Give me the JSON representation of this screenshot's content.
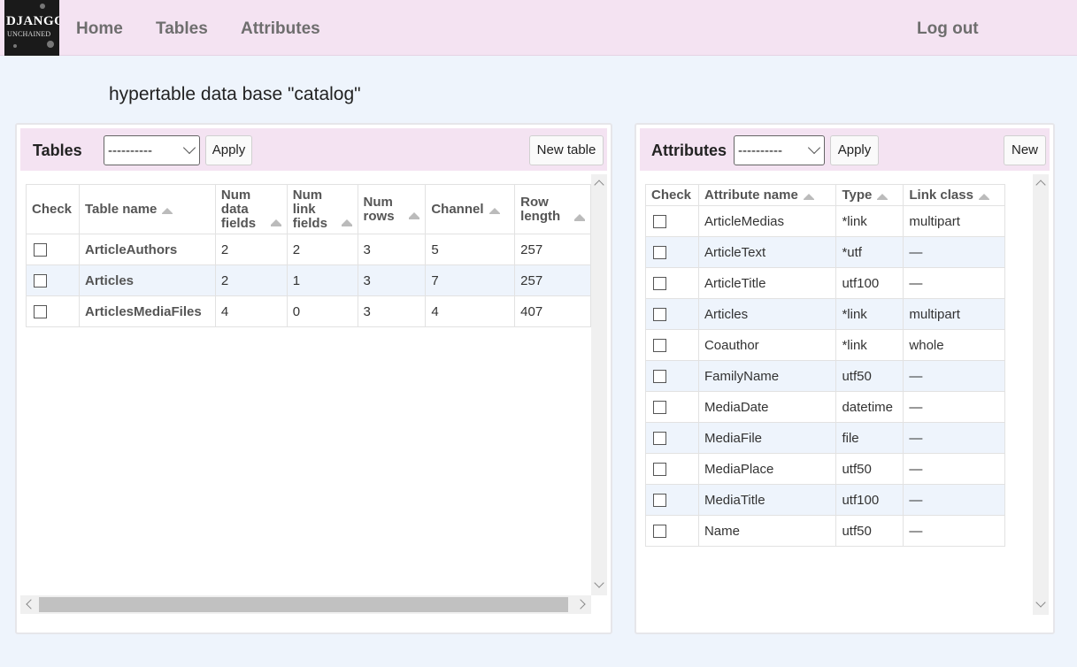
{
  "nav": {
    "logo_line1": "DJANGO",
    "logo_line2": "UNCHAINED",
    "home": "Home",
    "tables": "Tables",
    "attributes": "Attributes",
    "logout": "Log out"
  },
  "page_title": "hypertable data base \"catalog\"",
  "tables_panel": {
    "title": "Tables",
    "select_value": "----------",
    "apply_label": "Apply",
    "new_label": "New table",
    "columns": {
      "check": "Check",
      "table_name": "Table name",
      "num_data_1": "Num",
      "num_data_2": "data",
      "num_data_3": "fields",
      "num_link_1": "Num",
      "num_link_2": "link",
      "num_link_3": "fields",
      "num_rows_1": "Num",
      "num_rows_2": "rows",
      "channel": "Channel",
      "row_length_1": "Row",
      "row_length_2": "length"
    },
    "rows": [
      {
        "name": "ArticleAuthors",
        "data_fields": "2",
        "link_fields": "2",
        "rows": "3",
        "channel": "5",
        "row_length": "257"
      },
      {
        "name": "Articles",
        "data_fields": "2",
        "link_fields": "1",
        "rows": "3",
        "channel": "7",
        "row_length": "257"
      },
      {
        "name": "ArticlesMediaFiles",
        "data_fields": "4",
        "link_fields": "0",
        "rows": "3",
        "channel": "4",
        "row_length": "407"
      }
    ]
  },
  "attributes_panel": {
    "title": "Attributes",
    "select_value": "----------",
    "apply_label": "Apply",
    "new_label": "New",
    "columns": {
      "check": "Check",
      "attribute_name": "Attribute name",
      "type": "Type",
      "link_class": "Link class"
    },
    "rows": [
      {
        "name": "ArticleMedias",
        "type": "*link",
        "link_class": "multipart"
      },
      {
        "name": "ArticleText",
        "type": "*utf",
        "link_class": "—"
      },
      {
        "name": "ArticleTitle",
        "type": "utf100",
        "link_class": "—"
      },
      {
        "name": "Articles",
        "type": "*link",
        "link_class": "multipart"
      },
      {
        "name": "Coauthor",
        "type": "*link",
        "link_class": "whole"
      },
      {
        "name": "FamilyName",
        "type": "utf50",
        "link_class": "—"
      },
      {
        "name": "MediaDate",
        "type": "datetime",
        "link_class": "—"
      },
      {
        "name": "MediaFile",
        "type": "file",
        "link_class": "—"
      },
      {
        "name": "MediaPlace",
        "type": "utf50",
        "link_class": "—"
      },
      {
        "name": "MediaTitle",
        "type": "utf100",
        "link_class": "—"
      },
      {
        "name": "Name",
        "type": "utf50",
        "link_class": "—"
      }
    ]
  }
}
